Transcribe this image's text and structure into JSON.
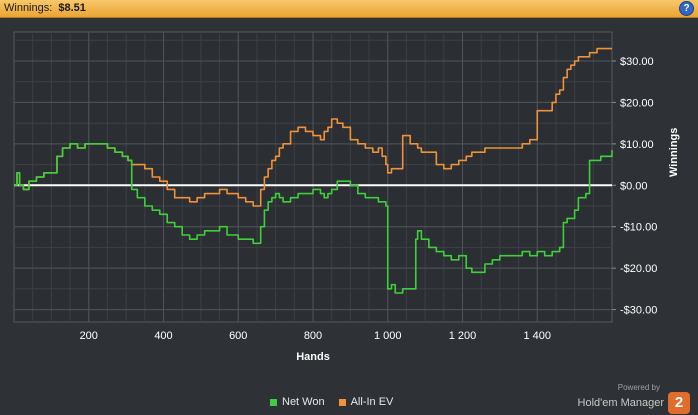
{
  "header": {
    "title_label": "Winnings:",
    "title_value": "$8.51",
    "help_icon": "question-icon"
  },
  "colors": {
    "net_won": "#3ed03a",
    "allin_ev": "#f0923a",
    "grid": "#4b4f55",
    "zero_line": "#ffffff"
  },
  "legend": {
    "net_won_label": "Net Won",
    "allin_label": "All-In EV"
  },
  "brand": {
    "powered_by": "Powered by",
    "name": "Hold'em Manager",
    "logo": "2"
  },
  "chart_data": {
    "type": "line",
    "xlabel": "Hands",
    "ylabel": "Winnings",
    "xlim": [
      0,
      1600
    ],
    "ylim": [
      -33,
      37
    ],
    "x_ticks": [
      200,
      400,
      600,
      800,
      1000,
      1200,
      1400
    ],
    "x_tick_labels": [
      "200",
      "400",
      "600",
      "800",
      "1 000",
      "1 200",
      "1 400"
    ],
    "y_ticks": [
      30,
      20,
      10,
      0,
      -10,
      -20,
      -30
    ],
    "y_tick_labels": [
      "$30.00",
      "$20.00",
      "$10.00",
      "$0.00",
      "-$10.00",
      "-$20.00",
      "-$30.00"
    ],
    "grid": true,
    "legend_position": "bottom",
    "series": [
      {
        "name": "Net Won",
        "x": [
          0,
          8,
          15,
          25,
          40,
          60,
          80,
          100,
          115,
          130,
          150,
          170,
          190,
          210,
          230,
          250,
          270,
          290,
          305,
          315,
          330,
          350,
          370,
          390,
          410,
          430,
          450,
          470,
          490,
          510,
          530,
          550,
          570,
          590,
          600,
          620,
          640,
          660,
          670,
          680,
          690,
          700,
          710,
          720,
          740,
          760,
          780,
          800,
          820,
          830,
          840,
          850,
          865,
          880,
          900,
          920,
          940,
          960,
          975,
          985,
          995,
          1000,
          1010,
          1020,
          1040,
          1060,
          1075,
          1080,
          1090,
          1110,
          1130,
          1150,
          1170,
          1190,
          1210,
          1225,
          1240,
          1260,
          1280,
          1300,
          1320,
          1340,
          1360,
          1380,
          1400,
          1420,
          1440,
          1450,
          1460,
          1470,
          1480,
          1490,
          1500,
          1510,
          1520,
          1530,
          1540,
          1550,
          1560,
          1570,
          1580,
          1590,
          1600
        ],
        "values": [
          0,
          3,
          0,
          -1,
          1,
          2,
          3,
          3,
          7,
          9,
          10,
          9,
          10,
          10,
          10,
          9,
          8,
          7,
          6,
          -1,
          -3,
          -5,
          -6,
          -7,
          -9,
          -10,
          -12,
          -13,
          -12,
          -11,
          -11,
          -10,
          -12,
          -12,
          -13,
          -13,
          -14,
          -10,
          -6,
          -4,
          -3,
          -2,
          -3,
          -4,
          -3,
          -2,
          -2,
          -1,
          -2,
          -3,
          -2,
          -1,
          1,
          1,
          0,
          -2,
          -3,
          -3,
          -4,
          -4,
          -5,
          -25,
          -24,
          -26,
          -25,
          -25,
          -13,
          -11,
          -13,
          -15,
          -16,
          -17,
          -18,
          -17,
          -20,
          -21,
          -21,
          -19,
          -18,
          -17,
          -17,
          -17,
          -16,
          -17,
          -16,
          -17,
          -16,
          -16,
          -15,
          -9,
          -8,
          -8,
          -6,
          -3,
          -3,
          -2,
          6,
          6,
          6,
          7,
          7,
          7,
          8.51
        ]
      },
      {
        "name": "All-In EV",
        "x": [
          0,
          8,
          15,
          25,
          40,
          60,
          80,
          100,
          115,
          130,
          150,
          170,
          190,
          210,
          230,
          250,
          270,
          290,
          305,
          315,
          330,
          350,
          370,
          390,
          410,
          430,
          450,
          470,
          490,
          510,
          530,
          550,
          570,
          590,
          600,
          620,
          640,
          660,
          670,
          680,
          690,
          700,
          710,
          720,
          740,
          760,
          780,
          800,
          820,
          830,
          840,
          850,
          865,
          880,
          900,
          920,
          940,
          960,
          975,
          985,
          995,
          1000,
          1010,
          1020,
          1040,
          1060,
          1075,
          1080,
          1090,
          1110,
          1130,
          1150,
          1170,
          1190,
          1210,
          1225,
          1240,
          1260,
          1280,
          1300,
          1320,
          1340,
          1360,
          1380,
          1400,
          1420,
          1440,
          1450,
          1460,
          1470,
          1480,
          1490,
          1500,
          1510,
          1520,
          1530,
          1540,
          1550,
          1560,
          1570,
          1580,
          1590,
          1600
        ],
        "values": [
          0,
          3,
          0,
          -1,
          1,
          2,
          3,
          3,
          7,
          9,
          10,
          9,
          10,
          10,
          10,
          9,
          8,
          7,
          6,
          5,
          5,
          4,
          2,
          1,
          -1,
          -3,
          -3,
          -4,
          -3,
          -2,
          -2,
          -1,
          -2,
          -2,
          -3,
          -4,
          -5,
          -1,
          2,
          4,
          6,
          7,
          9,
          10,
          13,
          14,
          13,
          12,
          11,
          13,
          14,
          16,
          15,
          14,
          11,
          10,
          9,
          8,
          9,
          7,
          5,
          3,
          4,
          4,
          12,
          10,
          10,
          9,
          8,
          8,
          5,
          4,
          5,
          6,
          7,
          8,
          8,
          9,
          9,
          9,
          9,
          9,
          10,
          11,
          18,
          18,
          20,
          22,
          23,
          26,
          28,
          29,
          30,
          31,
          31,
          31,
          32,
          32,
          33,
          33,
          33,
          33,
          33
        ]
      }
    ]
  }
}
